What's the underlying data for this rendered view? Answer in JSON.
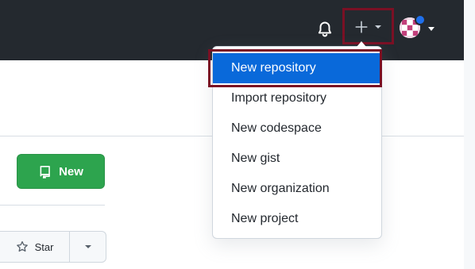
{
  "header": {
    "icons": {
      "bell": "bell-icon",
      "plus": "plus-icon",
      "avatar": "avatar"
    }
  },
  "menu": {
    "items": [
      {
        "label": "New repository",
        "active": true
      },
      {
        "label": "Import repository"
      },
      {
        "label": "New codespace"
      },
      {
        "label": "New gist"
      },
      {
        "label": "New organization"
      },
      {
        "label": "New project"
      }
    ]
  },
  "repo_list": {
    "new_button_label": "New"
  },
  "star": {
    "label": "Star"
  },
  "colors": {
    "header_bg": "#24292f",
    "accent_blue": "#0969da",
    "primary_green": "#2da44e",
    "highlight_red": "#7a1024"
  }
}
